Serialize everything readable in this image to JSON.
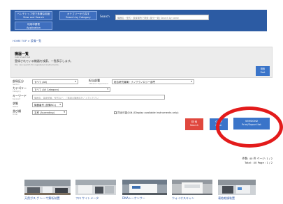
{
  "header": {
    "btn1_line1": "ベンチトップ型で多様な用途",
    "btn1_line2": "View and Search",
    "btn2_line1": "カテゴリーから探す",
    "btn2_line2": "Search by Category",
    "btn3_line1": "利用申請書",
    "btn3_line2": "Application",
    "search_label": "Search",
    "search_placeholder": "機器名・型式・設置場所で検索 (部分一致) Search by name"
  },
  "breadcrumb": "HOME  TOP  >  設備一覧",
  "heading": {
    "title": "機器一覧",
    "subtitle": "Instrument list",
    "desc": "登録されている機器を検索、一覧表示します。",
    "desc_en": "You can search for registered instruments.",
    "post_line1": "検索",
    "post_line2": "Post"
  },
  "form": {
    "dept_label": "部局区分",
    "dept_label_en": "Section",
    "dept_value": "すべて (All)",
    "org_label": "担当部署",
    "org_label_en": "Affiliated department",
    "org_value": "総合研究機構・ナノテクノロジー部門",
    "category_label": "カテゴリー",
    "category_label_en": "Category",
    "category_value": "すべて (All Category)",
    "keyword_label": "キーワード",
    "keyword_label_en": "Keyword",
    "keyword_placeholder": "機器名、装置型番、型式など、ご希望の機器名をご入力ください",
    "status_label": "状態",
    "status_label_en": "Status",
    "status_value": "機器番号 (設備NO.)",
    "order_label": "並び順",
    "order_label_en": "Order",
    "order_value": "名称 (Ascending)",
    "checkbox_label": "貸出可能のみ (Display available instruments only)"
  },
  "actions": {
    "search_line1": "検 索",
    "search_line2": "Search",
    "clear_line1": "クリア",
    "clear_line2": "Clear",
    "export_line1": "VERSION2",
    "export_line2": "Print/Export list"
  },
  "result_info": {
    "line1": "件数: 40 件 ページ: 1 / 2",
    "line2": "Total : 40  Page : 1 / 2"
  },
  "items": [
    {
      "caption": "天然ガス ゲ レーザ解析装置"
    },
    {
      "caption": "フロ サイトメータ"
    },
    {
      "caption": "DNAシーケンサー"
    },
    {
      "caption": "ウォイオスキャン"
    },
    {
      "caption": "凍結乾燥装置"
    }
  ],
  "colors": {
    "header_bg": "#2c5ba3",
    "accent_blue": "#3a74c9",
    "search_red": "#e0483e",
    "highlight_circle": "#e31b1b"
  }
}
